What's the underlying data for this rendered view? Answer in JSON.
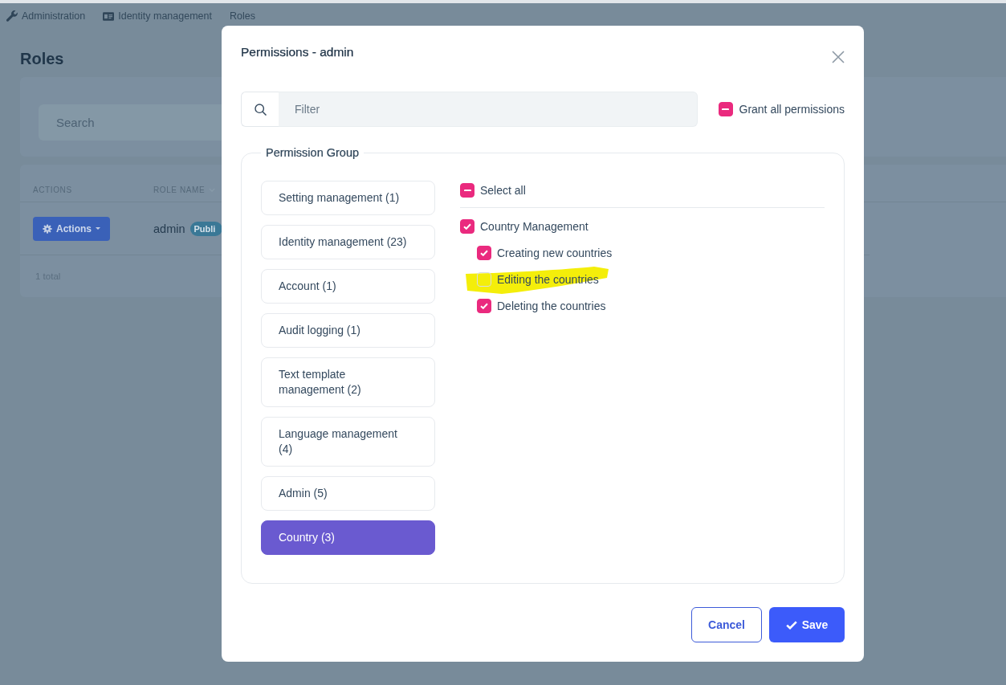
{
  "breadcrumb": [
    {
      "label": "Administration"
    },
    {
      "label": "Identity management"
    },
    {
      "label": "Roles"
    }
  ],
  "page": {
    "title": "Roles",
    "search": {
      "placeholder": "Search"
    },
    "table": {
      "columns": [
        {
          "label": "ACTIONS",
          "sortable": false
        },
        {
          "label": "ROLE NAME",
          "sortable": true
        }
      ],
      "rows": [
        {
          "actions": "Actions",
          "role_name": "admin",
          "badge": "Publi"
        }
      ],
      "footer": "1 total"
    }
  },
  "dialog": {
    "title": "Permissions - admin",
    "filter": {
      "placeholder": "Filter"
    },
    "grant_all": {
      "label": "Grant all permissions",
      "indeterminate": true
    },
    "permission_group": {
      "legend": "Permission Group",
      "groups": [
        {
          "label": "Setting management (1)",
          "selected": false
        },
        {
          "label": "Identity management (23)",
          "selected": false
        },
        {
          "label": "Account (1)",
          "selected": false
        },
        {
          "label": "Audit logging (1)",
          "selected": false
        },
        {
          "label": "Text template management (2)",
          "selected": false
        },
        {
          "label": "Language management (4)",
          "selected": false
        },
        {
          "label": "Admin (5)",
          "selected": false
        },
        {
          "label": "Country (3)",
          "selected": true
        }
      ],
      "select_all": {
        "label": "Select all",
        "indeterminate": true
      },
      "permissions": [
        {
          "label": "Country Management",
          "checked": true,
          "highlighted": false,
          "children": [
            {
              "label": "Creating new countries",
              "checked": true,
              "highlighted": false
            },
            {
              "label": "Editing the countries",
              "checked": false,
              "highlighted": true
            },
            {
              "label": "Deleting the countries",
              "checked": true,
              "highlighted": false
            }
          ]
        }
      ]
    },
    "buttons": [
      {
        "label": "Cancel",
        "kind": "secondary"
      },
      {
        "label": "Save",
        "kind": "primary"
      }
    ]
  }
}
